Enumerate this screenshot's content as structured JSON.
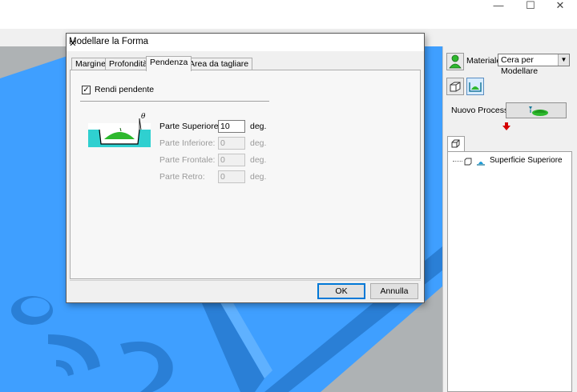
{
  "window": {
    "minimize_glyph": "—",
    "maximize_glyph": "☐",
    "close_glyph": "✕"
  },
  "dialog": {
    "title": "Modellare la Forma",
    "close_glyph": "✕",
    "tabs": [
      {
        "label": "Margine",
        "active": false
      },
      {
        "label": "Profondità",
        "active": false
      },
      {
        "label": "Pendenza",
        "active": true
      },
      {
        "label": "Area da tagliare",
        "active": false
      }
    ],
    "slope_checkbox": {
      "label": "Rendi pendente",
      "checked": true,
      "mark": "✓"
    },
    "angle_symbol": "θ",
    "fields": [
      {
        "label": "Parte Superiore:",
        "value": "10",
        "unit": "deg.",
        "enabled": true
      },
      {
        "label": "Parte Inferiore:",
        "value": "0",
        "unit": "deg.",
        "enabled": false
      },
      {
        "label": "Parte Frontale:",
        "value": "0",
        "unit": "deg.",
        "enabled": false
      },
      {
        "label": "Parte Retro:",
        "value": "0",
        "unit": "deg.",
        "enabled": false
      }
    ],
    "ok_label": "OK",
    "cancel_label": "Annulla"
  },
  "right_panel": {
    "material_label": "Materiale",
    "material_value": "Cera per Modellare",
    "select_arrow": "▼",
    "new_process_label": "Nuovo Processo",
    "tree_items": [
      {
        "label": "Superficie Superiore"
      }
    ]
  },
  "colors": {
    "model_blue": "#3f9fff",
    "model_shade": "#2a7fd6",
    "viewport_gray": "#aeb2b4",
    "accent_green": "#2db82d",
    "arrow_red": "#d40000",
    "default_button_border": "#0078d7"
  },
  "icons": [
    "minimize-icon",
    "maximize-icon",
    "close-icon",
    "material-person-icon",
    "box-view-icon",
    "process-icon",
    "new-process-machine-icon",
    "down-arrow-icon",
    "tree-tab-icon",
    "tree-box-icon",
    "surface-icon",
    "slope-diagram-icon"
  ]
}
